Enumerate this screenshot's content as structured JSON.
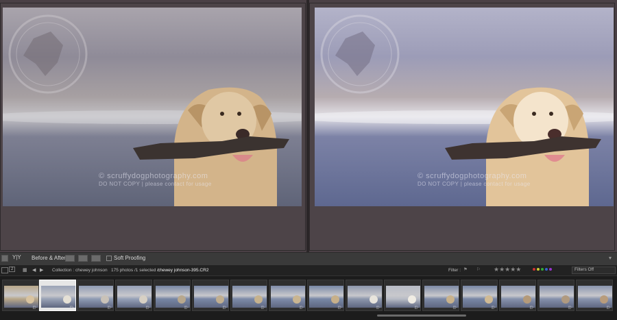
{
  "toolbar": {
    "before_after_label": "Before & After :",
    "soft_proofing_label": "Soft Proofing",
    "view_mode_label": "Y|Y"
  },
  "filmstrip_header": {
    "page_num": "2",
    "collection_label": "Collection : chewey johnson",
    "count_label": "175 photos /1 selected /",
    "filename": "chewey johnson-395.CR2",
    "filter_label": "Filter :",
    "filters_off": "Filters Off",
    "stars": "★★★★★"
  },
  "watermark": {
    "line1": "© scruffydogphotography.com",
    "line2": "DO NOT COPY | please contact for usage"
  },
  "colors": {
    "accent_red": "#c33",
    "accent_yellow": "#cc3",
    "accent_green": "#3a3",
    "accent_blue": "#36c",
    "accent_purple": "#93c"
  },
  "thumbnails": [
    {
      "id": "t1",
      "badge": "◫▫"
    },
    {
      "id": "t2",
      "badge": "◫▫"
    },
    {
      "id": "t3",
      "badge": "◫▫"
    },
    {
      "id": "t4",
      "badge": "◫▫"
    },
    {
      "id": "t5",
      "badge": "◫▫"
    },
    {
      "id": "t6",
      "badge": "◫▫"
    },
    {
      "id": "t7",
      "badge": "◫▫"
    },
    {
      "id": "t8",
      "badge": "◫▫"
    },
    {
      "id": "t9",
      "badge": "◫▫"
    },
    {
      "id": "t10",
      "badge": "◫▫"
    },
    {
      "id": "t11",
      "badge": "◫▫"
    },
    {
      "id": "t12",
      "badge": "◫▫"
    },
    {
      "id": "t13",
      "badge": "◫▫"
    },
    {
      "id": "t14",
      "badge": "◫▫"
    },
    {
      "id": "t15",
      "badge": "◫▫"
    },
    {
      "id": "t16",
      "badge": "◫▫"
    }
  ]
}
